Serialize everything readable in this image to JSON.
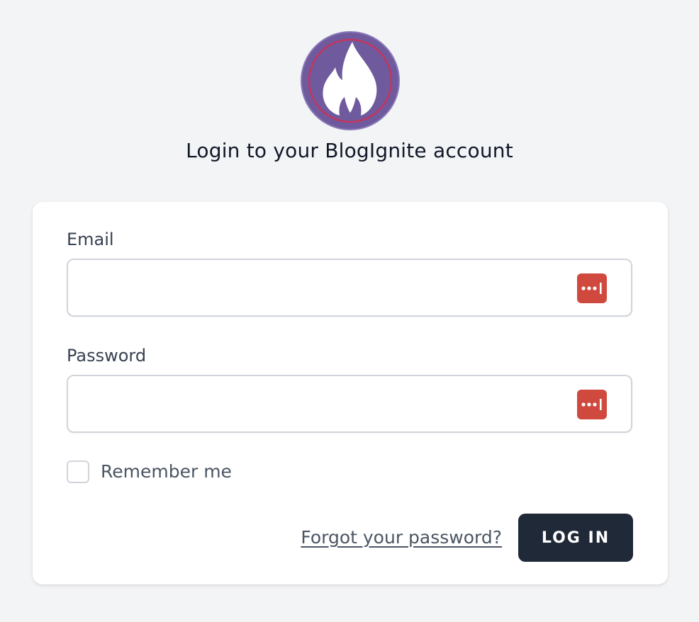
{
  "brand": {
    "logo_icon": "flame-icon",
    "logo_colors": {
      "circle_fill": "#6f5a9e",
      "ring": "#c1365f",
      "flame": "#ffffff"
    },
    "heading": "Login to your BlogIgnite account"
  },
  "form": {
    "email": {
      "label": "Email",
      "value": "",
      "placeholder": "",
      "autofill_icon": "password-manager-icon"
    },
    "password": {
      "label": "Password",
      "value": "",
      "placeholder": "",
      "autofill_icon": "password-manager-icon"
    },
    "remember_me": {
      "label": "Remember me",
      "checked": false
    },
    "forgot_link": "Forgot your password?",
    "submit_label": "LOG IN"
  },
  "colors": {
    "page_background": "#f3f4f6",
    "card_background": "#ffffff",
    "button_background": "#1f2937",
    "autofill_icon_background": "#d0493e"
  }
}
